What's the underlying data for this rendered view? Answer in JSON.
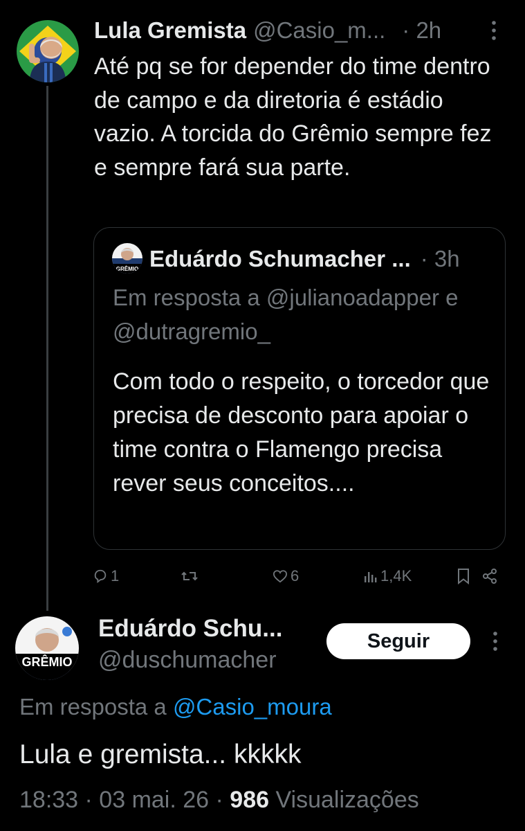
{
  "reply_tweet": {
    "author_name": "Lula Gremista",
    "author_handle": "@Casio_m...",
    "time": "· 2h",
    "text": "Até pq se for depender do time dentro de campo e da diretoria é estádio vazio. A torcida do Grêmio sempre fez e sempre fará sua parte.",
    "quote": {
      "author_name": "Eduárdo Schumacher ...",
      "time": "· 3h",
      "avatar_badge": "GRÊMIO",
      "reply_context": "Em resposta a @julianoadapper e @dutragremio_",
      "text": "Com todo o respeito, o torcedor que precisa de desconto para apoiar o time contra o Flamengo precisa rever seus conceitos...."
    },
    "actions": {
      "replies": "1",
      "retweets": "",
      "likes": "6",
      "views": "1,4K"
    },
    "icons": [
      "reply-icon",
      "retweet-icon",
      "like-icon",
      "views-icon",
      "bookmark-icon",
      "share-icon",
      "more-icon"
    ]
  },
  "main_tweet": {
    "author_name": "Eduárdo Schu...",
    "author_handle": "@duschumacher",
    "avatar_badge": "GRÊMIO",
    "follow_label": "Seguir",
    "reply_prefix": "Em resposta a ",
    "reply_mention": "@Casio_moura",
    "text": "Lula e gremista... kkkkk",
    "timestamp": "18:33 · 03 mai. 26 · ",
    "views_count": "986",
    "views_label": " Visualizações"
  },
  "colors": {
    "background": "#000000",
    "primary_text": "#e7e9ea",
    "secondary_text": "#71767b",
    "link": "#1d9bf0",
    "border": "#2f3336",
    "follow_button_bg": "#ffffff"
  }
}
